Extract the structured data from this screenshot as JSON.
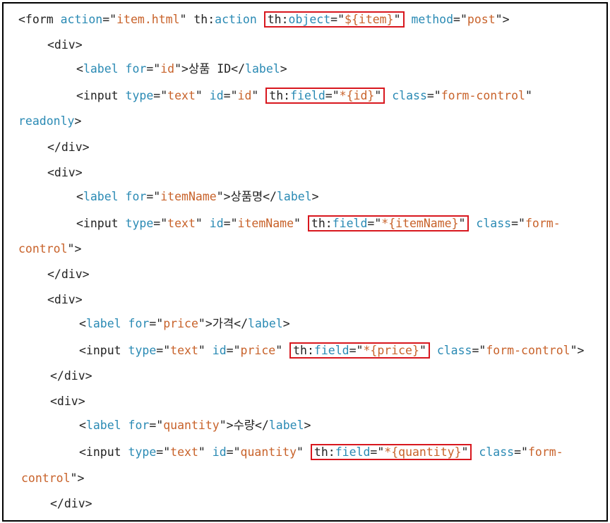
{
  "lines": [
    {
      "segments": [
        {
          "c": "t",
          "text": "<form "
        },
        {
          "c": "a",
          "text": "action"
        },
        {
          "c": "t",
          "text": "=\""
        },
        {
          "c": "v",
          "text": "item.html"
        },
        {
          "c": "t",
          "text": "\" th:"
        },
        {
          "c": "a",
          "text": "action "
        },
        {
          "hl": true,
          "parts": [
            {
              "c": "t",
              "text": "th:"
            },
            {
              "c": "a",
              "text": "object"
            },
            {
              "c": "t",
              "text": "=\""
            },
            {
              "c": "v",
              "text": "${item}"
            },
            {
              "c": "t",
              "text": "\""
            }
          ]
        },
        {
          "c": "t",
          "text": " "
        },
        {
          "c": "a",
          "text": "method"
        },
        {
          "c": "t",
          "text": "=\""
        },
        {
          "c": "v",
          "text": "post"
        },
        {
          "c": "t",
          "text": "\">"
        }
      ]
    },
    {
      "segments": [
        {
          "c": "t",
          "text": "<div>"
        }
      ]
    },
    {
      "segments": [
        {
          "c": "t",
          "text": "<"
        },
        {
          "c": "a",
          "text": "label "
        },
        {
          "c": "a",
          "text": "for"
        },
        {
          "c": "t",
          "text": "=\""
        },
        {
          "c": "v",
          "text": "id"
        },
        {
          "c": "t",
          "text": "\">상품 ID</"
        },
        {
          "c": "a",
          "text": "label"
        },
        {
          "c": "t",
          "text": ">"
        }
      ]
    },
    {
      "segments": [
        {
          "c": "t",
          "text": "<input "
        },
        {
          "c": "a",
          "text": "type"
        },
        {
          "c": "t",
          "text": "=\""
        },
        {
          "c": "v",
          "text": "text"
        },
        {
          "c": "t",
          "text": "\" "
        },
        {
          "c": "a",
          "text": "id"
        },
        {
          "c": "t",
          "text": "=\""
        },
        {
          "c": "v",
          "text": "id"
        },
        {
          "c": "t",
          "text": "\" "
        },
        {
          "hl": true,
          "parts": [
            {
              "c": "t",
              "text": "th:"
            },
            {
              "c": "a",
              "text": "field"
            },
            {
              "c": "t",
              "text": "=\""
            },
            {
              "c": "v",
              "text": "*{id}"
            },
            {
              "c": "t",
              "text": "\""
            }
          ]
        },
        {
          "c": "t",
          "text": " "
        },
        {
          "c": "a",
          "text": "class"
        },
        {
          "c": "t",
          "text": "=\""
        },
        {
          "c": "v",
          "text": "form-control"
        },
        {
          "c": "t",
          "text": "\""
        }
      ]
    },
    {
      "segments": [
        {
          "c": "a",
          "text": "readonly"
        },
        {
          "c": "t",
          "text": ">"
        }
      ]
    },
    {
      "segments": [
        {
          "c": "t",
          "text": "</div>"
        }
      ]
    },
    {
      "segments": [
        {
          "c": "t",
          "text": "<div>"
        }
      ]
    },
    {
      "segments": [
        {
          "c": "t",
          "text": "<"
        },
        {
          "c": "a",
          "text": "label "
        },
        {
          "c": "a",
          "text": "for"
        },
        {
          "c": "t",
          "text": "=\""
        },
        {
          "c": "v",
          "text": "itemName"
        },
        {
          "c": "t",
          "text": "\">상품명</"
        },
        {
          "c": "a",
          "text": "label"
        },
        {
          "c": "t",
          "text": ">"
        }
      ]
    },
    {
      "segments": [
        {
          "c": "t",
          "text": "<input "
        },
        {
          "c": "a",
          "text": "type"
        },
        {
          "c": "t",
          "text": "=\""
        },
        {
          "c": "v",
          "text": "text"
        },
        {
          "c": "t",
          "text": "\" "
        },
        {
          "c": "a",
          "text": "id"
        },
        {
          "c": "t",
          "text": "=\""
        },
        {
          "c": "v",
          "text": "itemName"
        },
        {
          "c": "t",
          "text": "\" "
        },
        {
          "hl": true,
          "parts": [
            {
              "c": "t",
              "text": "th:"
            },
            {
              "c": "a",
              "text": "field"
            },
            {
              "c": "t",
              "text": "=\""
            },
            {
              "c": "v",
              "text": "*{itemName}"
            },
            {
              "c": "t",
              "text": "\""
            }
          ]
        },
        {
          "c": "t",
          "text": " "
        },
        {
          "c": "a",
          "text": "class"
        },
        {
          "c": "t",
          "text": "=\""
        },
        {
          "c": "v",
          "text": "form-"
        }
      ]
    },
    {
      "segments": [
        {
          "c": "v",
          "text": "control"
        },
        {
          "c": "t",
          "text": "\">"
        }
      ]
    },
    {
      "segments": [
        {
          "c": "t",
          "text": "</div>"
        }
      ]
    },
    {
      "segments": [
        {
          "c": "t",
          "text": "<div>"
        }
      ]
    },
    {
      "segments": [
        {
          "c": "t",
          "text": "<"
        },
        {
          "c": "a",
          "text": "label "
        },
        {
          "c": "a",
          "text": "for"
        },
        {
          "c": "t",
          "text": "=\""
        },
        {
          "c": "v",
          "text": "price"
        },
        {
          "c": "t",
          "text": "\">가격</"
        },
        {
          "c": "a",
          "text": "label"
        },
        {
          "c": "t",
          "text": ">"
        }
      ]
    },
    {
      "segments": [
        {
          "c": "t",
          "text": "<input "
        },
        {
          "c": "a",
          "text": "type"
        },
        {
          "c": "t",
          "text": "=\""
        },
        {
          "c": "v",
          "text": "text"
        },
        {
          "c": "t",
          "text": "\" "
        },
        {
          "c": "a",
          "text": "id"
        },
        {
          "c": "t",
          "text": "=\""
        },
        {
          "c": "v",
          "text": "price"
        },
        {
          "c": "t",
          "text": "\" "
        },
        {
          "hl": true,
          "parts": [
            {
              "c": "t",
              "text": "th:"
            },
            {
              "c": "a",
              "text": "field"
            },
            {
              "c": "t",
              "text": "=\""
            },
            {
              "c": "v",
              "text": "*{price}"
            },
            {
              "c": "t",
              "text": "\""
            }
          ]
        },
        {
          "c": "t",
          "text": " "
        },
        {
          "c": "a",
          "text": "class"
        },
        {
          "c": "t",
          "text": "=\""
        },
        {
          "c": "v",
          "text": "form-control"
        },
        {
          "c": "t",
          "text": "\">"
        }
      ]
    },
    {
      "segments": [
        {
          "c": "t",
          "text": "</div>"
        }
      ]
    },
    {
      "segments": [
        {
          "c": "t",
          "text": "<div>"
        }
      ]
    },
    {
      "segments": [
        {
          "c": "t",
          "text": "<"
        },
        {
          "c": "a",
          "text": "label "
        },
        {
          "c": "a",
          "text": "for"
        },
        {
          "c": "t",
          "text": "=\""
        },
        {
          "c": "v",
          "text": "quantity"
        },
        {
          "c": "t",
          "text": "\">수량</"
        },
        {
          "c": "a",
          "text": "label"
        },
        {
          "c": "t",
          "text": ">"
        }
      ]
    },
    {
      "segments": [
        {
          "c": "t",
          "text": "<input "
        },
        {
          "c": "a",
          "text": "type"
        },
        {
          "c": "t",
          "text": "=\""
        },
        {
          "c": "v",
          "text": "text"
        },
        {
          "c": "t",
          "text": "\" "
        },
        {
          "c": "a",
          "text": "id"
        },
        {
          "c": "t",
          "text": "=\""
        },
        {
          "c": "v",
          "text": "quantity"
        },
        {
          "c": "t",
          "text": "\" "
        },
        {
          "hl": true,
          "parts": [
            {
              "c": "t",
              "text": "th:"
            },
            {
              "c": "a",
              "text": "field"
            },
            {
              "c": "t",
              "text": "=\""
            },
            {
              "c": "v",
              "text": "*{quantity}"
            },
            {
              "c": "t",
              "text": "\""
            }
          ]
        },
        {
          "c": "t",
          "text": " "
        },
        {
          "c": "a",
          "text": "class"
        },
        {
          "c": "t",
          "text": "=\""
        },
        {
          "c": "v",
          "text": "form-"
        }
      ]
    },
    {
      "segments": [
        {
          "c": "v",
          "text": "control"
        },
        {
          "c": "t",
          "text": "\">"
        }
      ]
    },
    {
      "segments": [
        {
          "c": "t",
          "text": "</div>"
        }
      ]
    }
  ],
  "colors": {
    "tag": "#222222",
    "attr": "#2a8ab4",
    "value": "#c8622a",
    "highlight_border": "#d8171e"
  }
}
